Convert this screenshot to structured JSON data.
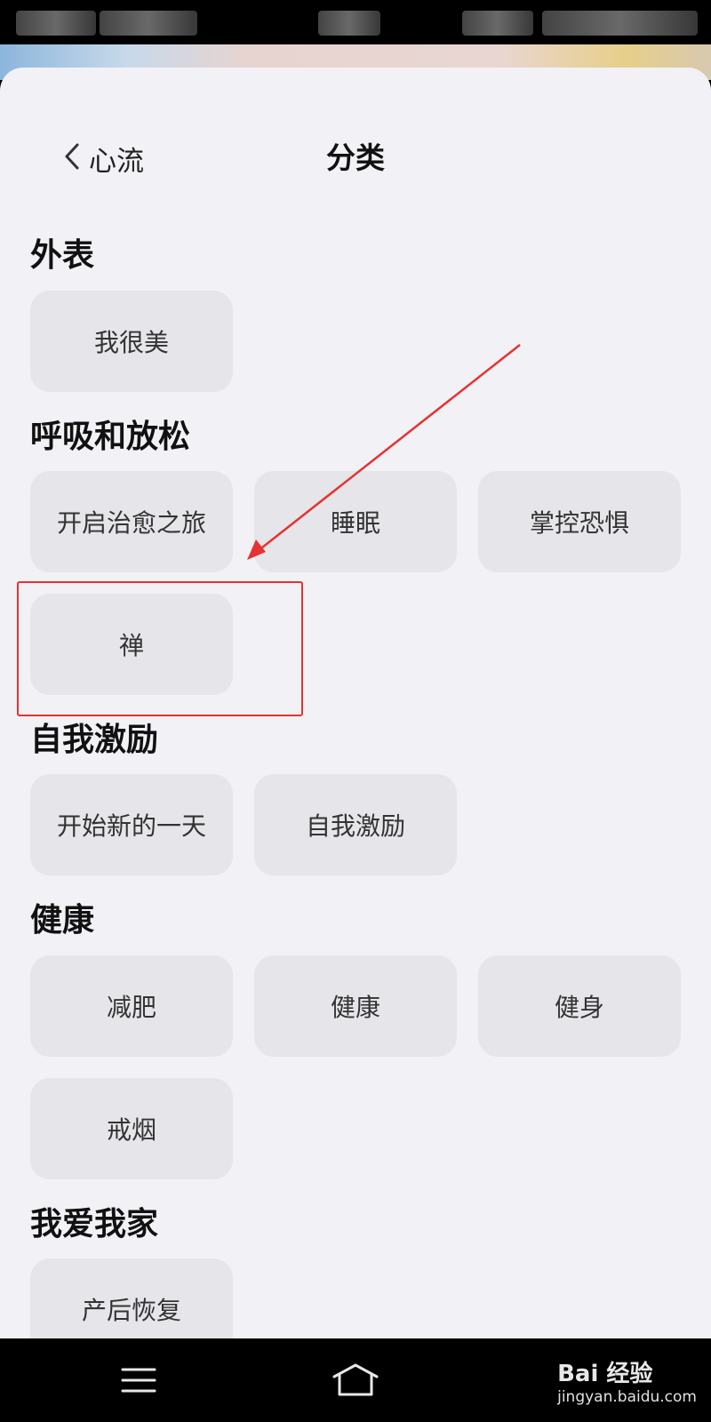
{
  "header": {
    "back_label": "心流",
    "title": "分类"
  },
  "sections": [
    {
      "title": "外表",
      "items": [
        "我很美"
      ]
    },
    {
      "title": "呼吸和放松",
      "items": [
        "开启治愈之旅",
        "睡眠",
        "掌控恐惧",
        "禅"
      ]
    },
    {
      "title": "自我激励",
      "items": [
        "开始新的一天",
        "自我激励"
      ]
    },
    {
      "title": "健康",
      "items": [
        "减肥",
        "健康",
        "健身",
        "戒烟"
      ]
    },
    {
      "title": "我爱我家",
      "items": [
        "产后恢复"
      ]
    }
  ],
  "annotation": {
    "color": "#e53232",
    "highlighted_item": "禅"
  },
  "navbar": {
    "icons": [
      "menu-icon",
      "home-icon"
    ]
  },
  "watermark": {
    "logo": "Bai 经验",
    "url": "jingyan.baidu.com"
  }
}
